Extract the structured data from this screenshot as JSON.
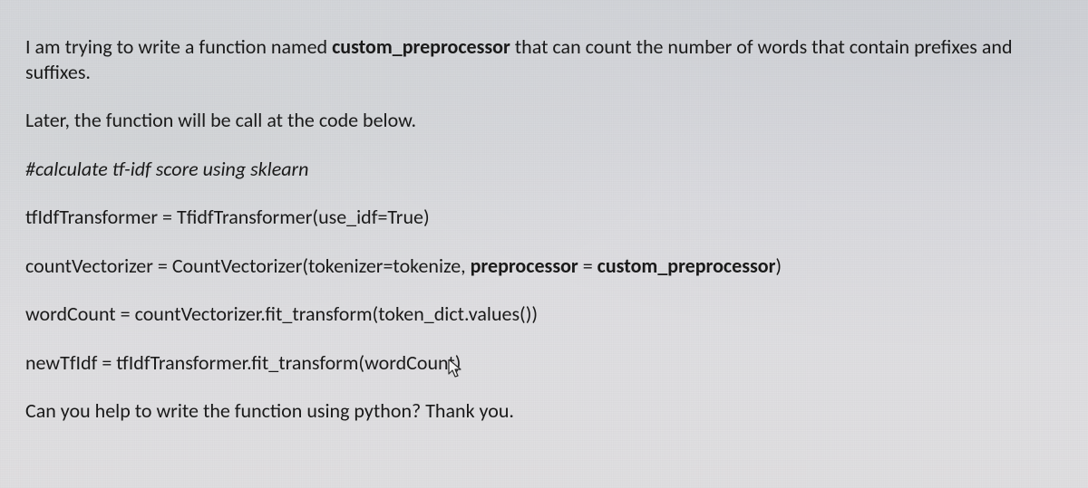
{
  "p1": {
    "pre": "I am trying to write a function named ",
    "bold": "custom_preprocessor",
    "post": " that can count the number of words that contain prefixes and suffixes."
  },
  "p2": "Later, the function will be call at the code below.",
  "p3": "#calculate tf-idf score using sklearn",
  "p4": "tfIdfTransformer = TfidfTransformer(use_idf=True)",
  "p5": {
    "pre": "countVectorizer = CountVectorizer(tokenizer=tokenize, ",
    "b1": "preprocessor",
    "mid": " = ",
    "b2": "custom_preprocessor",
    "post": ")"
  },
  "p6": "wordCount = countVectorizer.fit_transform(token_dict.values())",
  "p7": "newTfIdf = tfIdfTransformer.fit_transform(wordCount)",
  "p8": "Can you help to write the function using python? Thank you."
}
